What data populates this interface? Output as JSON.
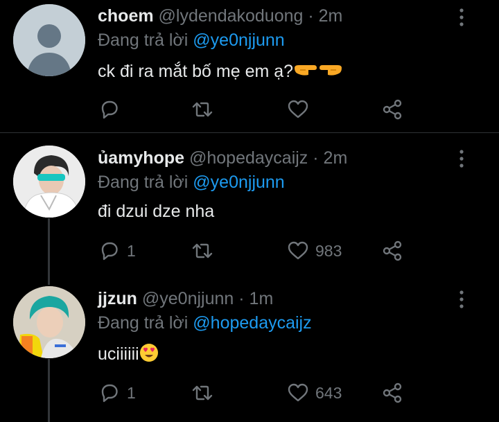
{
  "tweets": [
    {
      "name": "choem",
      "handle": "@lydendakoduong",
      "time": "· 2m",
      "reply_prefix": "Đang trả lời",
      "reply_to": "@ye0njjunn",
      "text": "ck đi ra mắt bố mẹ em ạ?",
      "emoji": [
        "backhand-index-pointing-right",
        "backhand-index-pointing-left"
      ],
      "replies": "",
      "likes": ""
    },
    {
      "name": "ủamyhope",
      "handle": "@hopedaycaijz",
      "time": "· 2m",
      "reply_prefix": "Đang trả lời",
      "reply_to": "@ye0njjunn",
      "text": "đi dzui dze nha",
      "replies": "1",
      "likes": "983"
    },
    {
      "name": "jjzun",
      "handle": "@ye0njjunn",
      "time": "· 1m",
      "reply_prefix": "Đang trả lời",
      "reply_to": "@hopedaycaijz",
      "text": "uciiiiii",
      "emoji": [
        "smiling-face-with-heart-eyes"
      ],
      "replies": "1",
      "likes": "643"
    }
  ],
  "colors": {
    "background": "#000000",
    "text": "#e7e9ea",
    "muted": "#71767b",
    "accent": "#1d9bf0"
  },
  "icons": [
    "reply-icon",
    "retweet-icon",
    "like-icon",
    "share-icon",
    "more-options-icon"
  ]
}
